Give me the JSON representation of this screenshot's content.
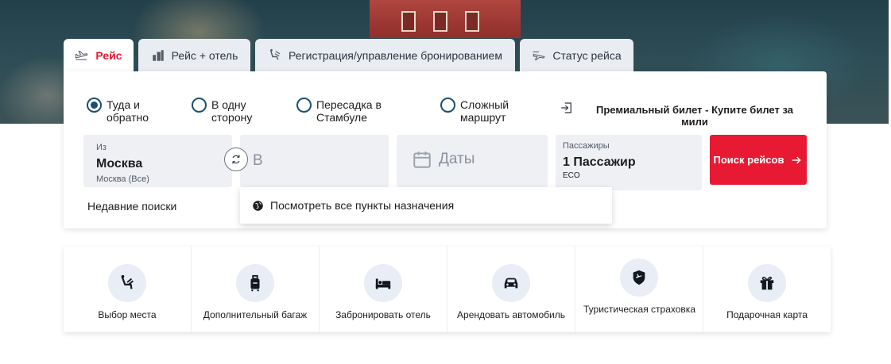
{
  "tabs": [
    {
      "label": "Рейс",
      "icon": "plane-icon",
      "active": true
    },
    {
      "label": "Рейс + отель",
      "icon": "hotel-icon",
      "active": false
    },
    {
      "label": "Регистрация/управление бронированием",
      "icon": "checkin-icon",
      "active": false
    },
    {
      "label": "Статус рейса",
      "icon": "flight-status-icon",
      "active": false
    }
  ],
  "trip_types": [
    {
      "label": "Туда и обратно",
      "selected": true
    },
    {
      "label": "В одну сторону",
      "selected": false
    },
    {
      "label": "Пересадка в Стамбуле",
      "selected": false
    },
    {
      "label": "Сложный маршрут",
      "selected": false
    }
  ],
  "premium": {
    "label": "Премиальный билет - Купите билет за мили",
    "icon": "sign-in-icon"
  },
  "from": {
    "label": "Из",
    "value": "Москва",
    "sub": "Москва (Все)"
  },
  "to": {
    "placeholder": "В"
  },
  "dates": {
    "placeholder": "Даты",
    "icon": "calendar-icon"
  },
  "passengers": {
    "label": "Пассажиры",
    "value": "1 Пассажир",
    "cabin": "ECO"
  },
  "search_button": "Поиск рейсов",
  "recent_searches": "Недавние поиски",
  "dropdown": {
    "label": "Посмотреть все пункты назначения",
    "icon": "globe-icon"
  },
  "services": [
    {
      "label": "Выбор места",
      "icon": "seat-icon"
    },
    {
      "label": "Дополнительный багаж",
      "icon": "luggage-icon"
    },
    {
      "label": "Забронировать отель",
      "icon": "bed-icon"
    },
    {
      "label": "Арендовать автомобиль",
      "icon": "car-icon"
    },
    {
      "label": "Туристическая страховка",
      "icon": "shield-plane-icon"
    },
    {
      "label": "Подарочная карта",
      "icon": "gift-icon"
    }
  ],
  "colors": {
    "accent": "#e81932",
    "brand": "#1a4f6e",
    "field_bg": "#eef0f4",
    "icon_bg": "#e8edf6"
  }
}
